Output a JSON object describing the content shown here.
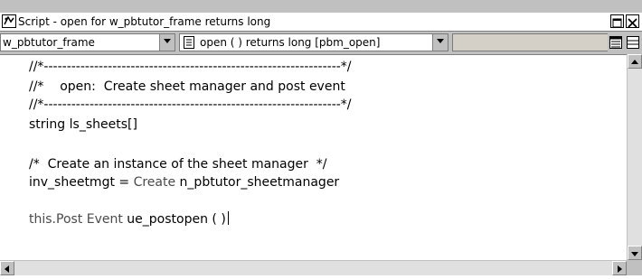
{
  "window": {
    "title": "Script - open for w_pbtutor_frame returns long"
  },
  "toolbar": {
    "object_selector": "w_pbtutor_frame",
    "event_selector": "open ( )  returns long [pbm_open]",
    "ancestor_selector": ""
  },
  "editor": {
    "lines": [
      "//*-----------------------------------------------------------------*/",
      "//*    open:  Create sheet manager and post event",
      "//*-----------------------------------------------------------------*/",
      "string ls_sheets[]",
      "",
      "/*  Create an instance of the sheet manager  */",
      "inv_sheetmgt = ",
      "Create",
      " n_pbtutor_sheetmanager",
      "",
      "this.",
      "Post Event",
      " ue_postopen ( )"
    ]
  },
  "colors": {
    "keyword": "#4a4a4a",
    "background": "#ffffff",
    "chrome": "#c0c0c0"
  },
  "icons": [
    "script-icon",
    "maximize-icon",
    "close-icon",
    "dropdown-arrow-icon",
    "event-script-icon",
    "paste-special-icon",
    "paste-statement-icon",
    "scroll-up-icon",
    "scroll-down-icon",
    "scroll-left-icon",
    "scroll-right-icon"
  ]
}
